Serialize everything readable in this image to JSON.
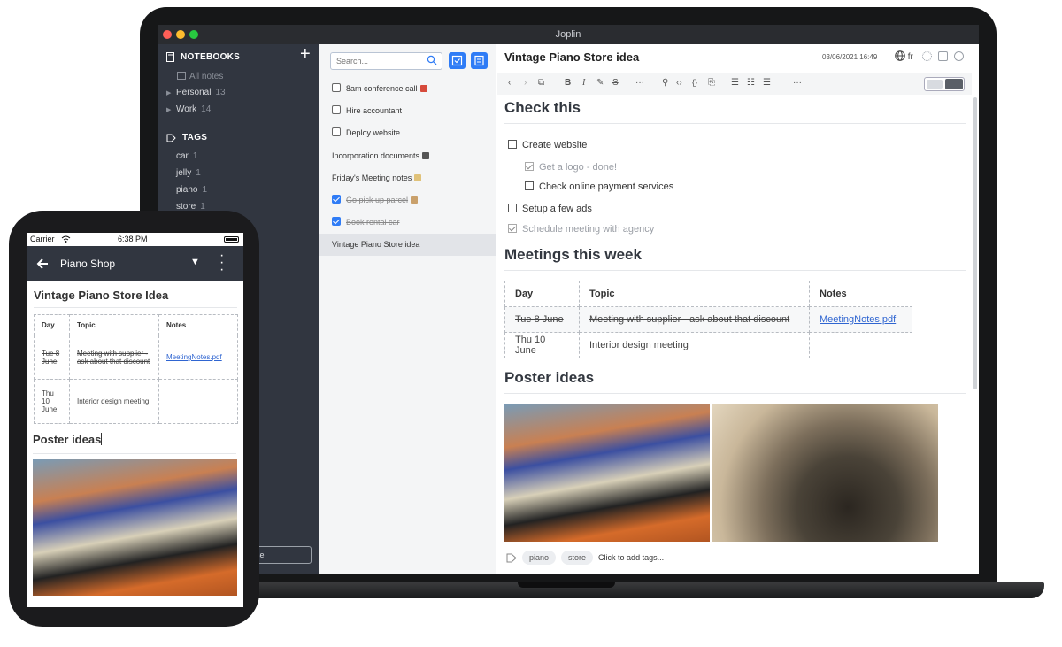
{
  "app": {
    "title": "Joplin"
  },
  "sidebar": {
    "notebooks_label": "NOTEBOOKS",
    "all_notes": "All notes",
    "notebooks": [
      {
        "label": "Personal",
        "count": "13"
      },
      {
        "label": "Work",
        "count": "14"
      }
    ],
    "tags_label": "TAGS",
    "tags": [
      {
        "label": "car",
        "count": "1"
      },
      {
        "label": "jelly",
        "count": "1"
      },
      {
        "label": "piano",
        "count": "1"
      },
      {
        "label": "store",
        "count": "1"
      }
    ],
    "sync_button_fragment": "se"
  },
  "note_list": {
    "search_placeholder": "Search...",
    "notes": [
      {
        "label": "8am conference call",
        "todo": true,
        "done": false
      },
      {
        "label": "Hire accountant",
        "todo": true,
        "done": false
      },
      {
        "label": "Deploy website",
        "todo": true,
        "done": false
      },
      {
        "label": "Incorporation documents",
        "todo": false,
        "done": false
      },
      {
        "label": "Friday's Meeting notes",
        "todo": false,
        "done": false
      },
      {
        "label": "Go pick up parcel",
        "todo": true,
        "done": true
      },
      {
        "label": "Book rental car",
        "todo": true,
        "done": true
      },
      {
        "label": "Vintage Piano Store idea",
        "todo": false,
        "done": false,
        "selected": true
      }
    ]
  },
  "editor": {
    "title": "Vintage Piano Store idea",
    "date": "03/06/2021 16:49",
    "lang": "fr",
    "h_check": "Check this",
    "checklist": [
      {
        "label": "Create website",
        "done": false
      },
      {
        "label": "Get a logo - done!",
        "done": true
      },
      {
        "label": "Check online payment services",
        "done": false
      },
      {
        "label": "Setup a few ads",
        "done": false
      },
      {
        "label": "Schedule meeting with agency",
        "done": true
      }
    ],
    "h_meetings": "Meetings this week",
    "table": {
      "headers": [
        "Day",
        "Topic",
        "Notes"
      ],
      "rows": [
        {
          "day": "Tue 8 June",
          "topic": "Meeting with supplier - ask about that discount",
          "notes": "MeetingNotes.pdf"
        },
        {
          "day": "Thu 10 June",
          "topic": "Interior design meeting",
          "notes": ""
        }
      ]
    },
    "h_poster": "Poster ideas",
    "tags": [
      "piano",
      "store"
    ],
    "add_tags": "Click to add tags..."
  },
  "phone": {
    "carrier": "Carrier",
    "time": "6:38 PM",
    "notebook": "Piano Shop",
    "title": "Vintage Piano Store Idea",
    "table": {
      "headers": [
        "Day",
        "Topic",
        "Notes"
      ],
      "rows": [
        {
          "day": "Tue 8 June",
          "topic": "Meeting with supplier - ask about that discount",
          "notes": "MeetingNotes.pdf"
        },
        {
          "day": "Thu 10 June",
          "topic": "Interior design meeting",
          "notes": ""
        }
      ]
    },
    "h_poster": "Poster ideas"
  },
  "colors": {
    "accent": "#2f7cf6",
    "sidebar": "#313640"
  }
}
